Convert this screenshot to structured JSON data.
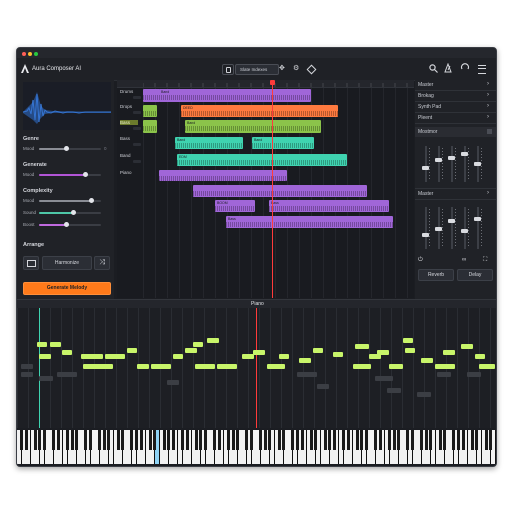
{
  "app": {
    "title": "Aura Composer AI"
  },
  "toolbar": {
    "project_name": "Slate Indexes"
  },
  "left_panel": {
    "genre_title": "Genre",
    "genre_slider_label": "Mood",
    "genre_slider_value": 0.45,
    "section2_title": "Generate",
    "section2_slider_label": "Mood",
    "section2_slider_value": 0.75,
    "complexity_title": "Complexity",
    "complexity_sliders": [
      {
        "label": "Mood",
        "value": 0.85
      },
      {
        "label": "Sound",
        "value": 0.55
      },
      {
        "label": "Boost",
        "value": 0.45
      }
    ],
    "arrange_title": "Arrange",
    "harmonize_label": "Harmonize",
    "generate_label": "Generate Melody"
  },
  "tracks": {
    "labels": [
      "Drums",
      "Drops",
      "Bass",
      "Bass",
      "Band",
      "Piano"
    ],
    "clip_labels": [
      "Band",
      "DEED",
      "Band",
      "Band",
      "Band",
      "EDM",
      "BOOM",
      "Bass",
      "Bass"
    ]
  },
  "mixer": {
    "items": [
      "Master",
      "Brokag",
      "Synth Pad",
      "Pleent",
      "Mostmor"
    ],
    "master2_title": "Master",
    "reverb_label": "Reverb",
    "delay_label": "Delay"
  },
  "piano_roll": {
    "title": "Piano"
  },
  "colors": {
    "accent": "#ff7a1a",
    "clip_purple": "#a066d8",
    "clip_orange": "#ff7a3f",
    "clip_green": "#8bc34a",
    "clip_teal": "#3fd3b0",
    "note": "#c8f56a",
    "playhead": "#ff3b3b"
  }
}
